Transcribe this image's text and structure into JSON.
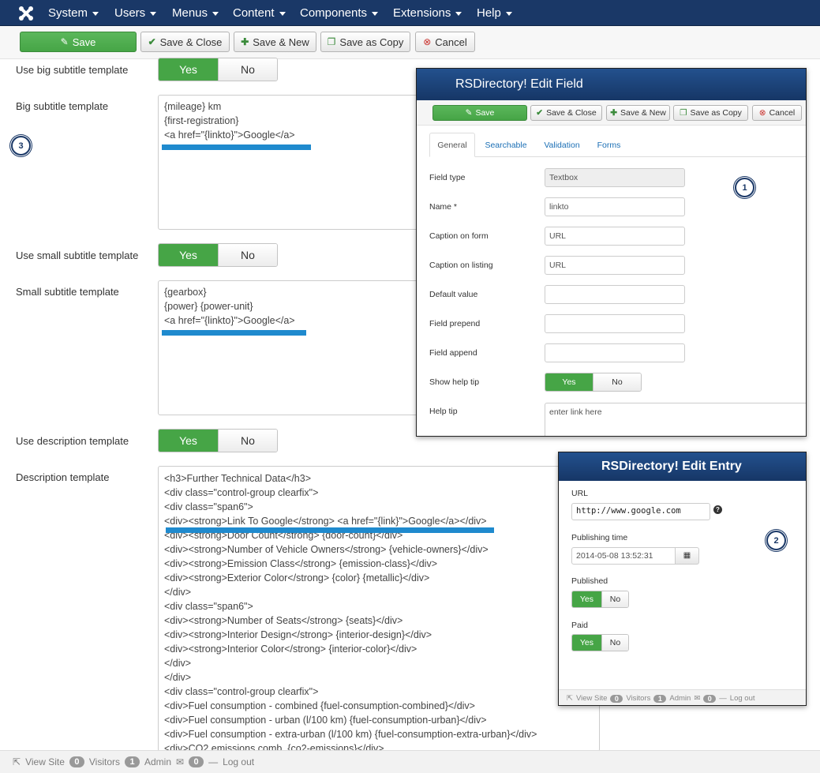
{
  "navbar": {
    "items": [
      "System",
      "Users",
      "Menus",
      "Content",
      "Components",
      "Extensions",
      "Help"
    ]
  },
  "toolbar": {
    "save": "Save",
    "save_close": "Save & Close",
    "save_new": "Save & New",
    "save_copy": "Save as Copy",
    "cancel": "Cancel"
  },
  "form": {
    "use_big_subtitle": {
      "label": "Use big subtitle template",
      "yes": "Yes",
      "no": "No",
      "value": "Yes"
    },
    "big_subtitle": {
      "label": "Big subtitle template",
      "value": "{mileage} km\n{first-registration}\n<a href=\"{linkto}\">Google</a>"
    },
    "use_small_subtitle": {
      "label": "Use small subtitle template",
      "yes": "Yes",
      "no": "No",
      "value": "Yes"
    },
    "small_subtitle": {
      "label": "Small subtitle template",
      "value": "{gearbox}\n{power} {power-unit}\n<a href=\"{linkto}\">Google</a>"
    },
    "use_description": {
      "label": "Use description template",
      "yes": "Yes",
      "no": "No",
      "value": "Yes"
    },
    "description": {
      "label": "Description template",
      "value": "<h3>Further Technical Data</h3>\n<div class=\"control-group clearfix\">\n<div class=\"span6\">\n<div><strong>Link To Google</strong> <a href=\"{link}\">Google</a></div>\n<div><strong>Door Count</strong> {door-count}</div>\n<div><strong>Number of Vehicle Owners</strong> {vehicle-owners}</div>\n<div><strong>Emission Class</strong> {emission-class}</div>\n<div><strong>Exterior Color</strong> {color} {metallic}</div>\n</div>\n<div class=\"span6\">\n<div><strong>Number of Seats</strong> {seats}</div>\n<div><strong>Interior Design</strong> {interior-design}</div>\n<div><strong>Interior Color</strong> {interior-color}</div>\n</div>\n</div>\n<div class=\"control-group clearfix\">\n<div>Fuel consumption - combined {fuel-consumption-combined}</div>\n<div>Fuel consumption - urban (l/100 km) {fuel-consumption-urban}</div>\n<div>Fuel consumption - extra-urban (l/100 km) {fuel-consumption-extra-urban}</div>\n<div>CO2 emissions comb. {co2-emissions}</div>"
    }
  },
  "callouts": {
    "one": "1",
    "two": "2",
    "three": "3"
  },
  "footer": {
    "view_site": "View Site",
    "visitors_count": "0",
    "visitors_label": "Visitors",
    "admin_count": "1",
    "admin_label": "Admin",
    "messages_count": "0",
    "logout": "Log out"
  },
  "edit_field": {
    "title": "RSDirectory! Edit Field",
    "buttons": {
      "save": "Save",
      "save_close": "Save & Close",
      "save_new": "Save & New",
      "save_copy": "Save as Copy",
      "cancel": "Cancel"
    },
    "tabs": [
      "General",
      "Searchable",
      "Validation",
      "Forms"
    ],
    "active_tab": "General",
    "fields": {
      "field_type": {
        "label": "Field type",
        "value": "Textbox"
      },
      "name": {
        "label": "Name *",
        "value": "linkto"
      },
      "caption_form": {
        "label": "Caption on form",
        "value": "URL"
      },
      "caption_listing": {
        "label": "Caption on listing",
        "value": "URL"
      },
      "default_value": {
        "label": "Default value",
        "value": ""
      },
      "prepend": {
        "label": "Field prepend",
        "value": ""
      },
      "append": {
        "label": "Field append",
        "value": ""
      },
      "show_help": {
        "label": "Show help tip",
        "yes": "Yes",
        "no": "No",
        "value": "Yes"
      },
      "help_tip": {
        "label": "Help tip",
        "value": "enter link here"
      }
    }
  },
  "edit_entry": {
    "title": "RSDirectory! Edit Entry",
    "url_label": "URL",
    "url_value": "http://www.google.com",
    "publishing_label": "Publishing time",
    "publishing_value": "2014-05-08 13:52:31",
    "published_label": "Published",
    "published_yes": "Yes",
    "published_no": "No",
    "published_value": "Yes",
    "paid_label": "Paid",
    "paid_yes": "Yes",
    "paid_no": "No",
    "paid_value": "Yes",
    "footer": {
      "view_site": "View Site",
      "visitors_count": "0",
      "visitors_label": "Visitors",
      "admin_count": "1",
      "admin_label": "Admin",
      "messages_count": "0",
      "logout": "Log out"
    }
  },
  "colors": {
    "navbar": "#1a3867",
    "green": "#46a546",
    "highlight": "#1f8ace"
  }
}
